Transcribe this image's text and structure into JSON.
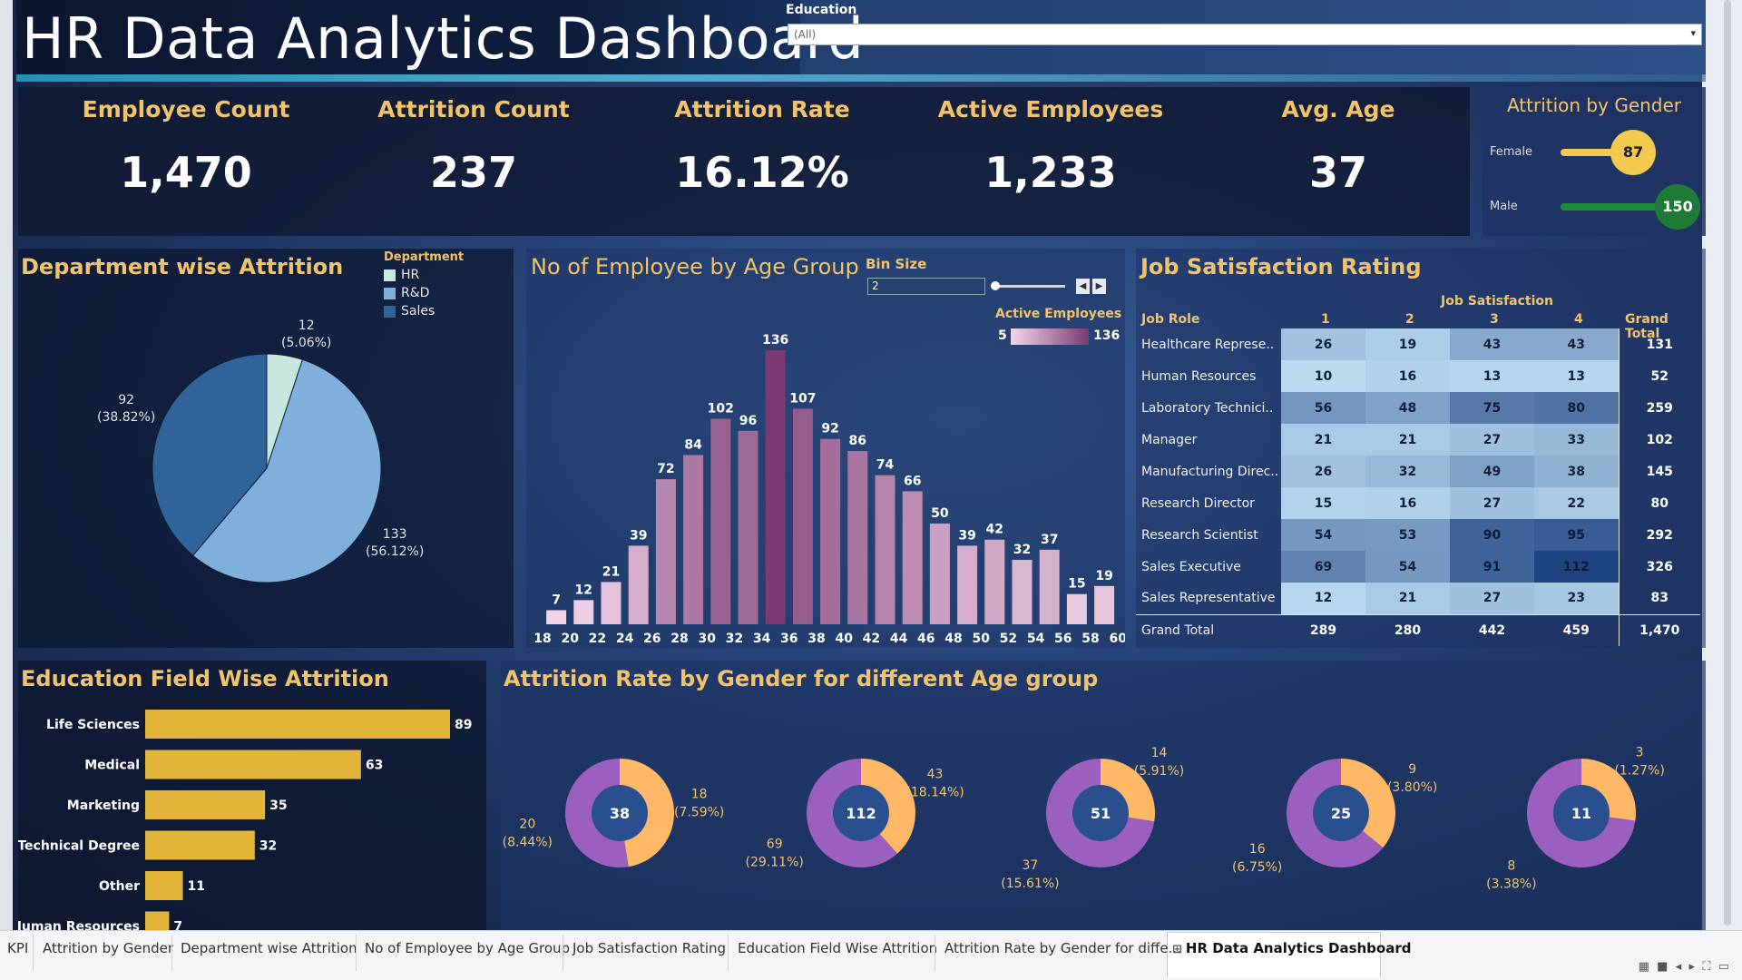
{
  "header": {
    "title": "HR Data Analytics Dashboard",
    "filter_label": "Education",
    "filter_value": "(All)"
  },
  "kpis": [
    {
      "label": "Employee Count",
      "value": "1,470"
    },
    {
      "label": "Attrition Count",
      "value": "237"
    },
    {
      "label": "Attrition Rate",
      "value": "16.12%"
    },
    {
      "label": "Active Employees",
      "value": "1,233"
    },
    {
      "label": "Avg. Age",
      "value": "37"
    }
  ],
  "gender": {
    "title": "Attrition by Gender",
    "female_label": "Female",
    "female_value": "87",
    "male_label": "Male",
    "male_value": "150",
    "colors": {
      "female": "#f2c94c",
      "male": "#1e8c3a"
    }
  },
  "department": {
    "title": "Department wise Attrition",
    "legend_title": "Department",
    "legend": [
      "HR",
      "R&D",
      "Sales"
    ],
    "labels": [
      {
        "value": "12",
        "pct": "(5.06%)"
      },
      {
        "value": "133",
        "pct": "(56.12%)"
      },
      {
        "value": "92",
        "pct": "(38.82%)"
      }
    ],
    "colors": [
      "#c8e8df",
      "#7fb0dc",
      "#2f639a"
    ]
  },
  "age_group": {
    "title": "No of Employee by Age Group",
    "bin_label": "Bin Size",
    "bin_value": "2",
    "legend_title": "Active Employees",
    "legend_min": "5",
    "legend_max": "136"
  },
  "job_satisfaction": {
    "title": "Job Satisfaction Rating",
    "col_group": "Job Satisfaction",
    "header_role": "Job Role",
    "header_cols": [
      "1",
      "2",
      "3",
      "4"
    ],
    "header_total": "Grand Total",
    "rows": [
      {
        "role": "Healthcare Represe..",
        "v": [
          "26",
          "19",
          "43",
          "43"
        ],
        "total": "131"
      },
      {
        "role": "Human Resources",
        "v": [
          "10",
          "16",
          "13",
          "13"
        ],
        "total": "52"
      },
      {
        "role": "Laboratory Technici..",
        "v": [
          "56",
          "48",
          "75",
          "80"
        ],
        "total": "259"
      },
      {
        "role": "Manager",
        "v": [
          "21",
          "21",
          "27",
          "33"
        ],
        "total": "102"
      },
      {
        "role": "Manufacturing Direc..",
        "v": [
          "26",
          "32",
          "49",
          "38"
        ],
        "total": "145"
      },
      {
        "role": "Research Director",
        "v": [
          "15",
          "16",
          "27",
          "22"
        ],
        "total": "80"
      },
      {
        "role": "Research Scientist",
        "v": [
          "54",
          "53",
          "90",
          "95"
        ],
        "total": "292"
      },
      {
        "role": "Sales Executive",
        "v": [
          "69",
          "54",
          "91",
          "112"
        ],
        "total": "326"
      },
      {
        "role": "Sales Representative",
        "v": [
          "12",
          "21",
          "27",
          "23"
        ],
        "total": "83"
      }
    ],
    "grand": {
      "label": "Grand Total",
      "v": [
        "289",
        "280",
        "442",
        "459"
      ],
      "total": "1,470"
    }
  },
  "education_field": {
    "title": "Education Field Wise Attrition"
  },
  "attr_gender_age": {
    "title": "Attrition Rate by Gender for different Age group",
    "donuts": [
      {
        "center": "38",
        "a_val": "18",
        "a_pct": "(7.59%)",
        "b_val": "20",
        "b_pct": "(8.44%)",
        "share": 0.474
      },
      {
        "center": "112",
        "a_val": "43",
        "a_pct": "(18.14%)",
        "b_val": "69",
        "b_pct": "(29.11%)",
        "share": 0.384
      },
      {
        "center": "51",
        "a_val": "14",
        "a_pct": "(5.91%)",
        "b_val": "37",
        "b_pct": "(15.61%)",
        "share": 0.275
      },
      {
        "center": "25",
        "a_val": "9",
        "a_pct": "(3.80%)",
        "b_val": "16",
        "b_pct": "(6.75%)",
        "share": 0.36
      },
      {
        "center": "11",
        "a_val": "3",
        "a_pct": "(1.27%)",
        "b_val": "8",
        "b_pct": "(3.38%)",
        "share": 0.273
      }
    ]
  },
  "tabs": [
    "KPI",
    "Attrition by Gender",
    "Department wise Attrition",
    "No of Employee by Age Group",
    "Job Satisfaction Rating",
    "Education Field Wise Attrition",
    "Attrition Rate by Gender for diffe...",
    "HR Data Analytics Dashboard"
  ],
  "chart_data": [
    {
      "type": "pie",
      "title": "Department wise Attrition",
      "categories": [
        "HR",
        "R&D",
        "Sales"
      ],
      "values": [
        12,
        133,
        92
      ]
    },
    {
      "type": "bar",
      "title": "No of Employee by Age Group",
      "categories": [
        "18",
        "20",
        "22",
        "24",
        "26",
        "28",
        "30",
        "32",
        "34",
        "36",
        "38",
        "40",
        "42",
        "44",
        "46",
        "48",
        "50",
        "52",
        "54",
        "56",
        "58",
        "60"
      ],
      "values": [
        7,
        12,
        21,
        39,
        72,
        84,
        102,
        96,
        136,
        107,
        92,
        86,
        74,
        66,
        50,
        39,
        42,
        32,
        37,
        15,
        19
      ],
      "ylim": [
        0,
        136
      ]
    },
    {
      "type": "bar",
      "title": "Education Field Wise Attrition",
      "categories": [
        "Life Sciences",
        "Medical",
        "Marketing",
        "Technical Degree",
        "Other",
        "Human Resources"
      ],
      "values": [
        89,
        63,
        35,
        32,
        11,
        7
      ],
      "orientation": "horizontal"
    },
    {
      "type": "pie",
      "title": "Attrition Rate by Gender for different Age group",
      "series": [
        {
          "values": [
            18,
            20
          ]
        },
        {
          "values": [
            43,
            69
          ]
        },
        {
          "values": [
            14,
            37
          ]
        },
        {
          "values": [
            9,
            16
          ]
        },
        {
          "values": [
            3,
            8
          ]
        }
      ]
    }
  ]
}
